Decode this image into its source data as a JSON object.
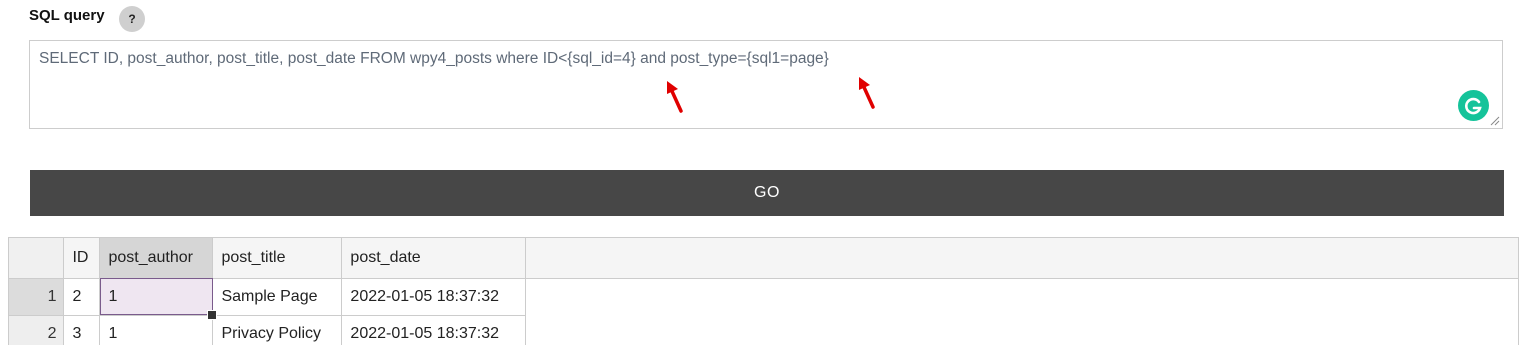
{
  "sql": {
    "label": "SQL query",
    "help_label": "?",
    "query": "SELECT ID, post_author, post_title, post_date FROM wpy4_posts where ID<{sql_id=4} and post_type={sql1=page}",
    "go_label": "GO"
  },
  "grid": {
    "columns": [
      "ID",
      "post_author",
      "post_title",
      "post_date"
    ],
    "rows": [
      {
        "num": "1",
        "cells": [
          "2",
          "1",
          "Sample Page",
          "2022-01-05 18:37:32"
        ]
      },
      {
        "num": "2",
        "cells": [
          "3",
          "1",
          "Privacy Policy",
          "2022-01-05 18:37:32"
        ]
      }
    ]
  },
  "colors": {
    "go_button_bg": "#474747",
    "grammarly_green": "#15c39a",
    "arrow_red": "#e00000"
  }
}
